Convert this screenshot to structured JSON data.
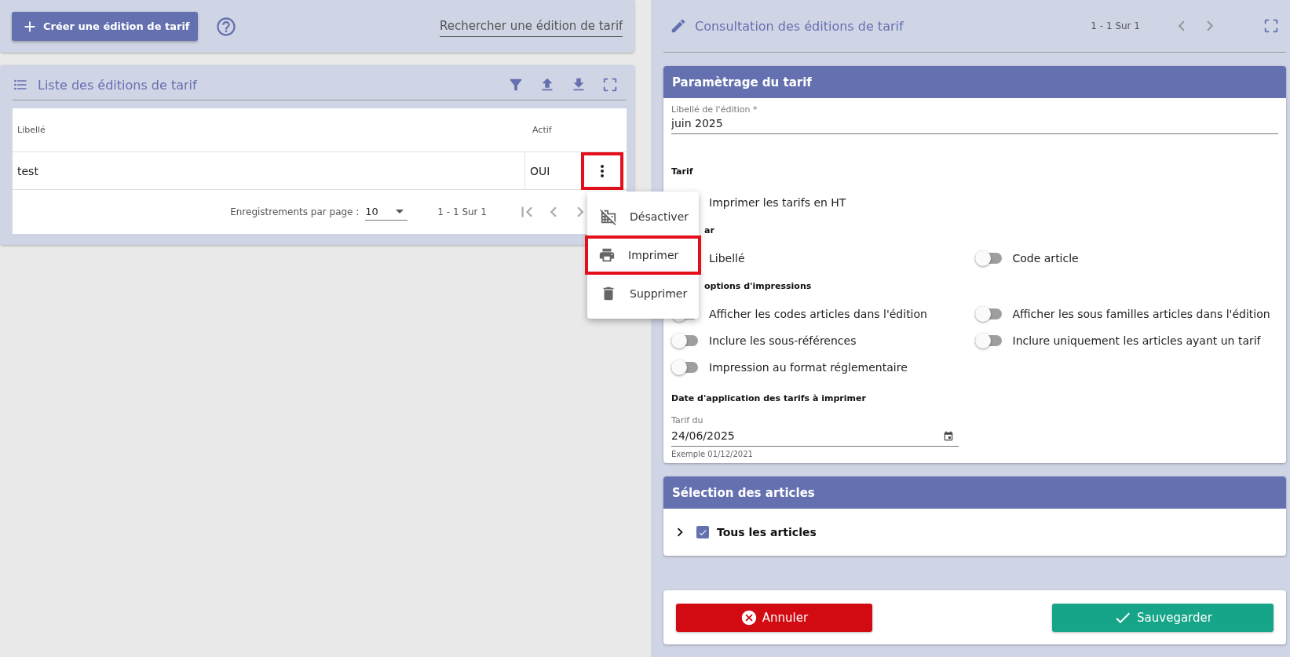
{
  "toolbar": {
    "create_button": "Créer une édition de tarif",
    "search": {
      "placeholder": "Rechercher une édition de tarif"
    }
  },
  "list": {
    "title": "Liste des éditions de tarif",
    "columns": [
      "Libellé",
      "Actif"
    ],
    "rows": [
      {
        "cells": [
          "test",
          "OUI"
        ],
        "menu_highlighted": true
      }
    ],
    "pagination": {
      "per_page_label": "Enregistrements par page :",
      "per_page": "10",
      "range": "1 - 1 Sur 1"
    }
  },
  "row_menu": {
    "items": [
      {
        "label": "Désactiver",
        "highlighted": false
      },
      {
        "label": "Imprimer",
        "highlighted": true
      },
      {
        "label": "Supprimer",
        "highlighted": false
      }
    ]
  },
  "detail": {
    "title": "Consultation des éditions de tarif",
    "range": "1 - 1 Sur 1"
  },
  "settings": {
    "title": "Paramètrage du tarif",
    "name_field": {
      "label": "Libellé de l'édition *",
      "value": "juin 2025"
    },
    "sections": [
      {
        "heading": "Tarif",
        "clipped": false,
        "options": [
          {
            "label": "Imprimer les tarifs en HT"
          }
        ]
      },
      {
        "heading": "ar",
        "clipped": true,
        "options": [
          {
            "label": "Libellé"
          },
          {
            "label": "Code article",
            "on": false
          }
        ]
      },
      {
        "heading": "options d'impressions",
        "clipped": true,
        "options": [
          {
            "label": "Afficher les codes articles dans l'édition",
            "on": false
          },
          {
            "label": "Afficher les sous familles articles dans l'édition",
            "on": false
          },
          {
            "label": "Inclure les sous-références",
            "on": false
          },
          {
            "label": "Inclure uniquement les articles ayant un tarif",
            "on": false
          },
          {
            "label": "Impression au format réglementaire",
            "on": false
          }
        ]
      }
    ],
    "date_heading": "Date d'application des tarifs à imprimer",
    "date_field": {
      "label": "Tarif du",
      "value": "24/06/2025",
      "hint": "Exemple 01/12/2021"
    }
  },
  "articles": {
    "title": "Sélection des articles",
    "items": [
      {
        "label": "Tous les articles",
        "checked": true,
        "expanded": false
      }
    ]
  },
  "actions": {
    "cancel": "Annuler",
    "save": "Sauvegarder"
  }
}
